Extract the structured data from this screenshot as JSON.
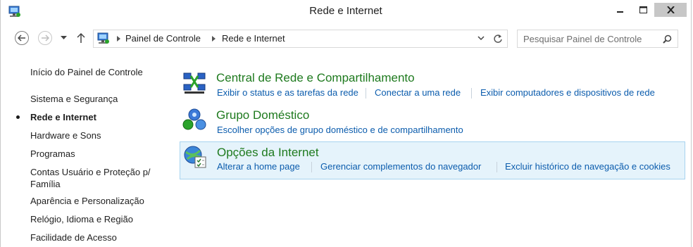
{
  "window": {
    "title": "Rede e Internet",
    "icons": {
      "app": "control-panel-icon",
      "minimize": "minimize-icon",
      "maximize": "maximize-icon",
      "close": "close-icon"
    }
  },
  "navigation": {
    "breadcrumbs": [
      "Painel de Controle",
      "Rede e Internet"
    ],
    "search_placeholder": "Pesquisar Painel de Controle",
    "icons": {
      "back": "back-arrow-icon",
      "forward": "forward-arrow-icon",
      "recent": "chevron-down-icon",
      "up": "up-arrow-icon",
      "refresh": "refresh-icon",
      "search": "search-icon"
    }
  },
  "sidebar": {
    "home": "Início do Painel de Controle",
    "items": [
      "Sistema e Segurança",
      "Rede e Internet",
      "Hardware e Sons",
      "Programas",
      "Contas Usuário e Proteção p/",
      "Família",
      "Aparência e Personalização",
      "Relógio, Idioma e Região",
      "Facilidade de Acesso"
    ],
    "current_index": 1
  },
  "sections": [
    {
      "title": "Central de Rede e Compartilhamento",
      "icon": "network-center-icon",
      "links": [
        "Exibir o status e as tarefas da rede",
        "Conectar a uma rede",
        "Exibir computadores e dispositivos de rede"
      ]
    },
    {
      "title": "Grupo Doméstico",
      "icon": "homegroup-icon",
      "links": [
        "Escolher opções de grupo doméstico e de compartilhamento"
      ]
    },
    {
      "title": "Opções da Internet",
      "icon": "internet-options-icon",
      "links": [
        "Alterar a home page",
        "Gerenciar complementos do navegador",
        "Excluir histórico de navegação e cookies"
      ]
    }
  ],
  "colors": {
    "section_title": "#1e7a1e",
    "link": "#0b5cad",
    "selected_bg": "#e5f3fb",
    "selected_border": "#a7d3ef",
    "close_btn": "#c7c7c7"
  }
}
